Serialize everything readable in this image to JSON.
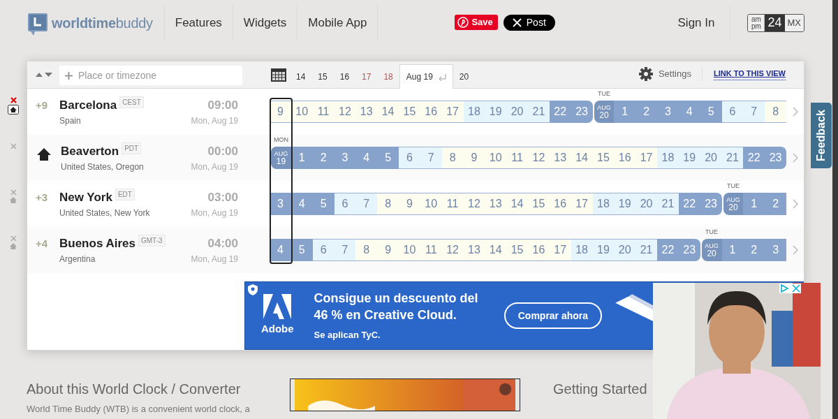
{
  "header": {
    "logo": "**worldtime**buddy",
    "nav": [
      "Features",
      "Widgets",
      "Mobile App"
    ],
    "share_buttons": [
      {
        "kind": "pinterest",
        "label": "Save"
      },
      {
        "kind": "x",
        "label": "Post"
      }
    ],
    "sign_in": "Sign In",
    "time_format": [
      {
        "label": "am pm",
        "selected": false
      },
      {
        "label": "24",
        "selected": true
      },
      {
        "label": "MX",
        "selected": false
      }
    ]
  },
  "toolbar": {
    "search": {
      "placeholder": "Place or timezone"
    },
    "dates": [
      {
        "label": "14",
        "weekend": false,
        "selected": false
      },
      {
        "label": "15",
        "weekend": false,
        "selected": false
      },
      {
        "label": "16",
        "weekend": false,
        "selected": false
      },
      {
        "label": "17",
        "weekend": true,
        "selected": false
      },
      {
        "label": "18",
        "weekend": true,
        "selected": false
      },
      {
        "label": "Aug 19",
        "weekend": false,
        "selected": true
      },
      {
        "label": "20",
        "weekend": false,
        "selected": false
      }
    ],
    "settings": "Settings",
    "link": "LINK TO THIS VIEW"
  },
  "locations": [
    {
      "offset": "+9",
      "home": false,
      "hover": true,
      "name": "Barcelona",
      "tz": "CEST",
      "region": "Spain",
      "time": "09:00",
      "date": "Mon, Aug 19",
      "timeline": [
        {
          "kind": "day",
          "hours": [
            "9",
            "10",
            "11",
            "12",
            "13",
            "14",
            "15",
            "16",
            "17"
          ]
        },
        {
          "kind": "twilight",
          "hours": [
            "18",
            "19",
            "20",
            "21"
          ]
        },
        {
          "kind": "night",
          "hours": [
            "22",
            "23"
          ]
        },
        {
          "kind": "date",
          "month": "AUG",
          "day": "20",
          "weekday": "TUE"
        },
        {
          "kind": "night",
          "hours": [
            "1",
            "2",
            "3",
            "4",
            "5"
          ]
        },
        {
          "kind": "twilight",
          "hours": [
            "6",
            "7"
          ]
        },
        {
          "kind": "day",
          "hours": [
            "8"
          ]
        }
      ]
    },
    {
      "home": true,
      "hover": false,
      "name": "Beaverton",
      "tz": "PDT",
      "region": "United States, Oregon",
      "time": "00:00",
      "date": "Mon, Aug 19",
      "timeline": [
        {
          "kind": "date",
          "month": "AUG",
          "day": "19",
          "weekday": "MON"
        },
        {
          "kind": "night",
          "hours": [
            "1",
            "2",
            "3",
            "4",
            "5"
          ]
        },
        {
          "kind": "twilight",
          "hours": [
            "6",
            "7"
          ]
        },
        {
          "kind": "day",
          "hours": [
            "8",
            "9",
            "10",
            "11",
            "12",
            "13",
            "14",
            "15",
            "16",
            "17"
          ]
        },
        {
          "kind": "twilight",
          "hours": [
            "18",
            "19",
            "20",
            "21"
          ]
        },
        {
          "kind": "night",
          "hours": [
            "22",
            "23"
          ]
        }
      ]
    },
    {
      "offset": "+3",
      "home": false,
      "hover": false,
      "name": "New York",
      "tz": "EDT",
      "region": "United States, New York",
      "time": "03:00",
      "date": "Mon, Aug 19",
      "timeline": [
        {
          "kind": "night",
          "hours": [
            "3",
            "4",
            "5"
          ]
        },
        {
          "kind": "twilight",
          "hours": [
            "6",
            "7"
          ]
        },
        {
          "kind": "day",
          "hours": [
            "8",
            "9",
            "10",
            "11",
            "12",
            "13",
            "14",
            "15",
            "16",
            "17"
          ]
        },
        {
          "kind": "twilight",
          "hours": [
            "18",
            "19",
            "20",
            "21"
          ]
        },
        {
          "kind": "night",
          "hours": [
            "22",
            "23"
          ]
        },
        {
          "kind": "date",
          "month": "AUG",
          "day": "20",
          "weekday": "TUE"
        },
        {
          "kind": "night",
          "hours": [
            "1",
            "2"
          ]
        }
      ]
    },
    {
      "offset": "+4",
      "home": false,
      "hover": false,
      "name": "Buenos Aires",
      "tz": "GMT-3",
      "region": "Argentina",
      "time": "04:00",
      "date": "Mon, Aug 19",
      "timeline": [
        {
          "kind": "night",
          "hours": [
            "4",
            "5"
          ]
        },
        {
          "kind": "twilight",
          "hours": [
            "6",
            "7"
          ]
        },
        {
          "kind": "day",
          "hours": [
            "8",
            "9",
            "10",
            "11",
            "12",
            "13",
            "14",
            "15",
            "16",
            "17"
          ]
        },
        {
          "kind": "twilight",
          "hours": [
            "18",
            "19",
            "20",
            "21"
          ]
        },
        {
          "kind": "night",
          "hours": [
            "22",
            "23"
          ]
        },
        {
          "kind": "date",
          "month": "AUG",
          "day": "20",
          "weekday": "TUE"
        },
        {
          "kind": "night",
          "hours": [
            "1",
            "2",
            "3"
          ]
        }
      ]
    }
  ],
  "ad": {
    "brand": "Adobe",
    "headline": "Consigue un descuento del 46 % en Creative Cloud.",
    "note": "Se aplican TyC.",
    "button": "Comprar ahora"
  },
  "feedback": "Feedback",
  "footer": {
    "about_title": "About this World Clock / Converter",
    "about_text": "World Time Buddy (WTB) is a convenient world clock, a",
    "getting_started": "Getting Started"
  }
}
